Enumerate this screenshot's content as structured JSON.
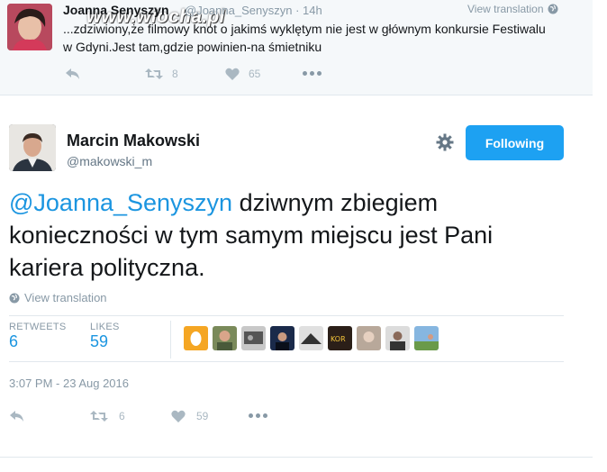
{
  "previous_tweet": {
    "author_name": "Joanna Senyszyn",
    "author_handle": "@Joanna_Senyszyn",
    "time": "· 14h",
    "view_translation": "View translation",
    "text": "...zdziwiony,że filmowy knot o jakimś wyklętym nie jest w głównym konkursie Festiwalu w Gdyni.Jest tam,gdzie powinien-na śmietniku",
    "watermark": "www.wiocha.pl",
    "retweets": "8",
    "likes": "65"
  },
  "main_tweet": {
    "author_name": "Marcin Makowski",
    "author_handle": "@makowski_m",
    "follow_label": "Following",
    "mention": "@Joanna_Senyszyn",
    "text_rest": " dziwnym zbiegiem konieczności w tym samym miejscu jest Pani kariera polityczna.",
    "view_translation": "View translation",
    "retweets_label": "RETWEETS",
    "retweets_count": "6",
    "likes_label": "LIKES",
    "likes_count": "59",
    "timestamp": "3:07 PM - 23 Aug 2016",
    "action_retweets": "6",
    "action_likes": "59"
  },
  "icons": [
    "reply-icon",
    "retweet-icon",
    "like-icon",
    "more-icon",
    "gear-icon",
    "globe-icon"
  ],
  "colors": {
    "accent": "#1da1f2",
    "link": "#1b95e0",
    "muted": "#8899a6",
    "text": "#14171a"
  }
}
